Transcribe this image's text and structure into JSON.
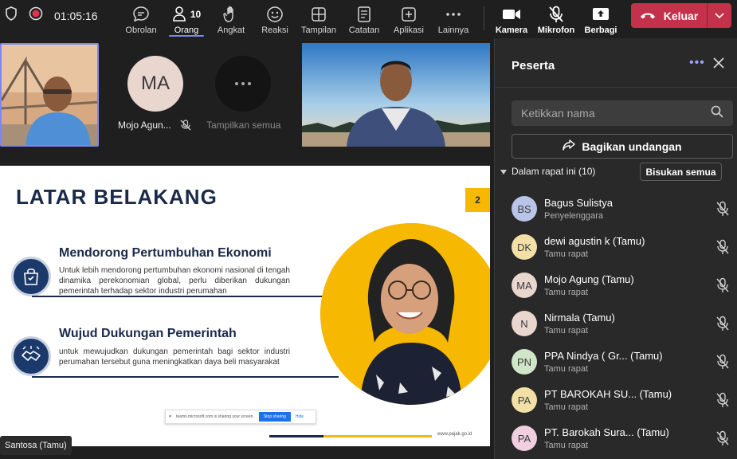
{
  "call": {
    "timer": "01:05:16"
  },
  "toolbar": {
    "chat": "Obrolan",
    "people": "Orang",
    "people_count": "10",
    "raise": "Angkat",
    "react": "Reaksi",
    "view": "Tampilan",
    "notes": "Catatan",
    "apps": "Aplikasi",
    "more": "Lainnya",
    "camera": "Kamera",
    "mic": "Mikrofon",
    "share": "Berbagi",
    "leave": "Keluar"
  },
  "stage": {
    "tile2_initials": "MA",
    "tile2_name": "Mojo Agun...",
    "tile3_label": "Tampilkan semua",
    "presenter_chip": "Santosa (Tamu)"
  },
  "slide": {
    "title": "LATAR BELAKANG",
    "page": "2",
    "sec1_title": "Mendorong Pertumbuhan Ekonomi",
    "sec1_body": "Untuk lebih mendorong pertumbuhan ekonomi nasional di tengah dinamika perekonomian global, perlu diberikan dukungan pemerintah terhadap sektor industri perumahan",
    "sec2_title": "Wujud Dukungan Pemerintah",
    "sec2_body": "untuk mewujudkan dukungan pemerintah bagi sektor industri perumahan tersebut guna meningkatkan daya beli masyarakat",
    "share_text": "teams.microsoft.com is sharing your screen.",
    "stop_label": "Stop sharing",
    "hide_label": "Hide",
    "footer_url": "www.pajak.go.id"
  },
  "panel": {
    "title": "Peserta",
    "search_placeholder": "Ketikkan nama",
    "invite": "Bagikan undangan",
    "section": "Dalam rapat ini (10)",
    "mute_all": "Bisukan semua",
    "participants": [
      {
        "initials": "BS",
        "name": "Bagus Sulistya",
        "role": "Penyelenggara",
        "color": "#b9c5e8"
      },
      {
        "initials": "DK",
        "name": "dewi agustin k (Tamu)",
        "role": "Tamu rapat",
        "color": "#f3e0a6"
      },
      {
        "initials": "MA",
        "name": "Mojo Agung (Tamu)",
        "role": "Tamu rapat",
        "color": "#e8d6cf"
      },
      {
        "initials": "N",
        "name": "Nirmala (Tamu)",
        "role": "Tamu rapat",
        "color": "#e8d6cf"
      },
      {
        "initials": "PN",
        "name": "PPA Nindya ( Gr...  (Tamu)",
        "role": "Tamu rapat",
        "color": "#cfe6c8"
      },
      {
        "initials": "PA",
        "name": "PT BAROKAH SU... (Tamu)",
        "role": "Tamu rapat",
        "color": "#f3e0a6"
      },
      {
        "initials": "PA",
        "name": "PT. Barokah Sura... (Tamu)",
        "role": "Tamu rapat",
        "color": "#f0cfe0"
      }
    ]
  }
}
